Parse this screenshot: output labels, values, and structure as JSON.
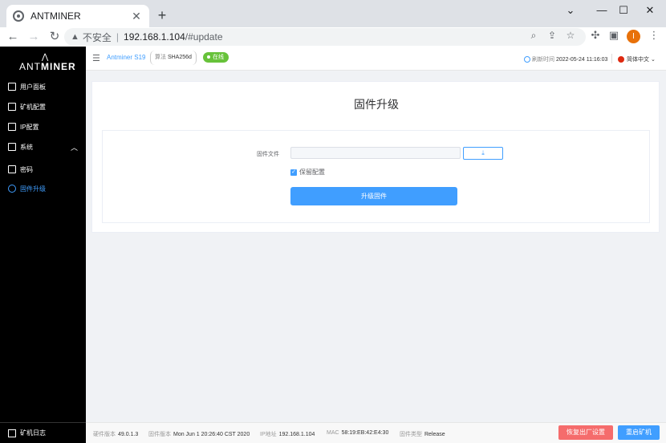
{
  "browser": {
    "tab_title": "ANTMINER",
    "tab_close": "✕",
    "new_tab": "+",
    "win_min": "⌄",
    "win_minimize": "—",
    "win_max": "☐",
    "win_close": "✕",
    "insecure_label": "不安全",
    "url_host": "192.168.1.104",
    "url_path": "/#update",
    "profile_initial": "I"
  },
  "sidebar": {
    "logo_ant": "ANT",
    "logo_miner": "MINER",
    "items": [
      {
        "label": "用户面板",
        "icon": "dashboard-icon"
      },
      {
        "label": "矿机配置",
        "icon": "config-icon"
      },
      {
        "label": "IP配置",
        "icon": "sliders-icon"
      },
      {
        "label": "系统",
        "icon": "system-icon",
        "chevron": "︿"
      },
      {
        "label": "密码",
        "icon": "lock-icon"
      },
      {
        "label": "固件升级",
        "icon": "firmware-icon",
        "active": true
      }
    ],
    "footer_label": "矿机日志"
  },
  "header": {
    "model": "Antminer S19",
    "algo_key": "算法",
    "algo_value": "SHA256d",
    "status": "在线",
    "refresh_key": "刷新时间",
    "refresh_value": "2022-05-24 11:16:03",
    "language": "简体中文 ⌄"
  },
  "main": {
    "title": "固件升级",
    "file_label": "固件文件",
    "upload_icon": "⤓",
    "keep_config_label": "保留配置",
    "keep_config_checked": true,
    "upgrade_button": "升级固件"
  },
  "footer": {
    "hw_key": "硬件版本",
    "hw_value": "49.0.1.3",
    "fw_key": "固件版本",
    "fw_value": "Mon Jun 1 20:26:40 CST 2020",
    "ip_key": "IP地址",
    "ip_value": "192.168.1.104",
    "mac_key": "MAC",
    "mac_value": "58:19:EB:42:E4:30",
    "type_key": "固件类型",
    "type_value": "Release",
    "reset_button": "恢复出厂设置",
    "reboot_button": "重启矿机"
  },
  "colors": {
    "accent": "#409eff",
    "online": "#67c23a",
    "danger": "#f56c6c",
    "sidebar": "#000000"
  }
}
